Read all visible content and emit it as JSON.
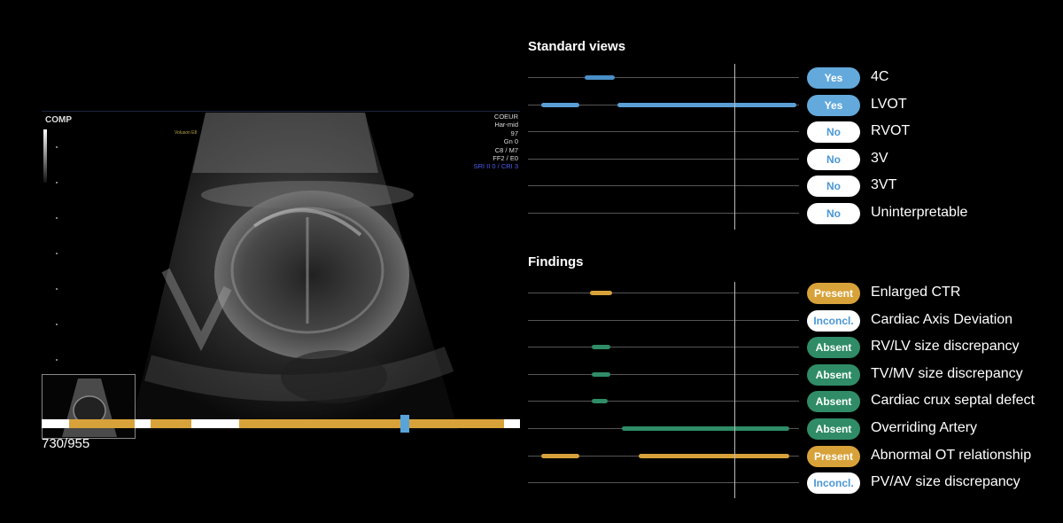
{
  "ultrasound": {
    "mode_label": "COMP",
    "probe_label": "Voluson E8",
    "settings": [
      "COEUR",
      "Har-mid",
      "97",
      "Gn  0",
      "C8 / M7",
      "FF2 / E0"
    ],
    "settings_highlight": "SRI II 0 / CRI 3",
    "frame_counter": "730/955"
  },
  "timeline": {
    "segments": [
      {
        "start": 0.058,
        "end": 0.194,
        "color": "#d8a23a"
      },
      {
        "start": 0.228,
        "end": 0.313,
        "color": "#d8a23a"
      },
      {
        "start": 0.413,
        "end": 0.966,
        "color": "#d8a23a"
      }
    ],
    "cursor_position": 0.76,
    "cursor_color": "#58a3d9"
  },
  "standard_views": {
    "title": "Standard views",
    "rows": [
      {
        "label": "4C",
        "status": "Yes",
        "status_class": "yes",
        "bars": [
          [
            0.21,
            0.32
          ]
        ],
        "bar_color": "#4a8fc7"
      },
      {
        "label": "LVOT",
        "status": "Yes",
        "status_class": "yes",
        "bars": [
          [
            0.05,
            0.19
          ],
          [
            0.33,
            0.99
          ]
        ],
        "bar_color": "#5a9fd6"
      },
      {
        "label": "RVOT",
        "status": "No",
        "status_class": "no",
        "bars": []
      },
      {
        "label": "3V",
        "status": "No",
        "status_class": "no",
        "bars": []
      },
      {
        "label": "3VT",
        "status": "No",
        "status_class": "no",
        "bars": []
      },
      {
        "label": "Uninterpretable",
        "status": "No",
        "status_class": "no",
        "bars": []
      }
    ]
  },
  "findings": {
    "title": "Findings",
    "rows": [
      {
        "label": "Enlarged CTR",
        "status": "Present",
        "status_class": "present",
        "bars": [
          [
            0.23,
            0.31
          ]
        ],
        "bar_color": "#d8a23a"
      },
      {
        "label": "Cardiac Axis Deviation",
        "status": "Inconcl.",
        "status_class": "inconcl",
        "bars": []
      },
      {
        "label": "RV/LV size discrepancy",
        "status": "Absent",
        "status_class": "absent",
        "bars": [
          [
            0.235,
            0.305
          ]
        ],
        "bar_color": "#2f8c66"
      },
      {
        "label": "TV/MV size discrepancy",
        "status": "Absent",
        "status_class": "absent",
        "bars": [
          [
            0.235,
            0.305
          ]
        ],
        "bar_color": "#2f8c66"
      },
      {
        "label": "Cardiac crux septal defect",
        "status": "Absent",
        "status_class": "absent",
        "bars": [
          [
            0.235,
            0.295
          ]
        ],
        "bar_color": "#2f8c66"
      },
      {
        "label": "Overriding Artery",
        "status": "Absent",
        "status_class": "absent",
        "bars": [
          [
            0.345,
            0.965
          ]
        ],
        "bar_color": "#2f8c66"
      },
      {
        "label": "Abnormal OT relationship",
        "status": "Present",
        "status_class": "present",
        "bars": [
          [
            0.05,
            0.19
          ],
          [
            0.41,
            0.965
          ]
        ],
        "bar_color": "#d8a23a"
      },
      {
        "label": "PV/AV size discrepancy",
        "status": "Inconcl.",
        "status_class": "inconcl",
        "bars": []
      }
    ]
  }
}
